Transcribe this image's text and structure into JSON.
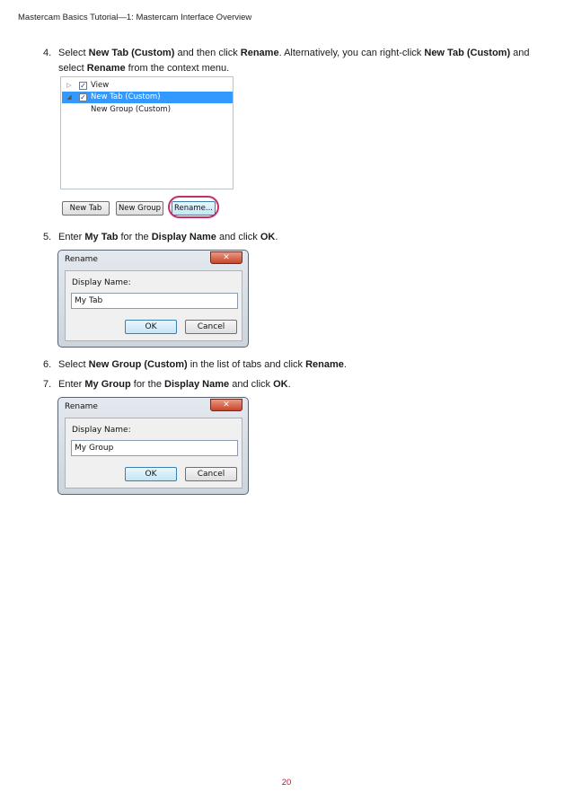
{
  "running_head": "Mastercam Basics Tutorial—1: Mastercam Interface Overview",
  "steps": [
    {
      "number": "4.",
      "parts": [
        {
          "text": "Select "
        },
        {
          "text": "New Tab (Custom)",
          "bold": true
        },
        {
          "text": " and then click "
        },
        {
          "text": "Rename",
          "bold": true
        },
        {
          "text": ". Alternatively, you can right-click "
        },
        {
          "text": "New Tab (Custom)",
          "bold": true
        },
        {
          "text": " and select "
        },
        {
          "text": "Rename",
          "bold": true
        },
        {
          "text": " from the context menu."
        }
      ]
    },
    {
      "number": "5.",
      "parts": [
        {
          "text": "Enter "
        },
        {
          "text": "My Tab",
          "bold": true
        },
        {
          "text": " for the "
        },
        {
          "text": "Display Name",
          "bold": true
        },
        {
          "text": " and click "
        },
        {
          "text": "OK",
          "bold": true
        },
        {
          "text": "."
        }
      ]
    },
    {
      "number": "6.",
      "parts": [
        {
          "text": "Select "
        },
        {
          "text": "New Group (Custom)",
          "bold": true
        },
        {
          "text": " in the list of tabs and click "
        },
        {
          "text": "Rename",
          "bold": true
        },
        {
          "text": "."
        }
      ]
    },
    {
      "number": "7.",
      "parts": [
        {
          "text": "Enter "
        },
        {
          "text": "My Group",
          "bold": true
        },
        {
          "text": " for the "
        },
        {
          "text": "Display Name",
          "bold": true
        },
        {
          "text": " and click "
        },
        {
          "text": "OK",
          "bold": true
        },
        {
          "text": "."
        }
      ]
    }
  ],
  "tree_screenshot": {
    "items": [
      {
        "label": "View",
        "checked": true,
        "selected": false,
        "expander": "▷"
      },
      {
        "label": "New Tab (Custom)",
        "checked": true,
        "selected": true,
        "expander": "◢"
      },
      {
        "label": "New Group (Custom)",
        "checked": false,
        "selected": false,
        "expander": ""
      }
    ],
    "buttons": {
      "new_tab": "New Tab",
      "new_group": "New Group",
      "rename": "Rename..."
    },
    "highlight_color": "#c0306a",
    "selection_color": "#3399ff"
  },
  "dialogs": [
    {
      "title": "Rename",
      "close_label": "✕",
      "field_label": "Display Name:",
      "value": "My Tab",
      "ok_label": "OK",
      "cancel_label": "Cancel"
    },
    {
      "title": "Rename",
      "close_label": "✕",
      "field_label": "Display Name:",
      "value": "My Group",
      "ok_label": "OK",
      "cancel_label": "Cancel"
    }
  ],
  "page_number": "20",
  "accent_color": "#c8102e"
}
